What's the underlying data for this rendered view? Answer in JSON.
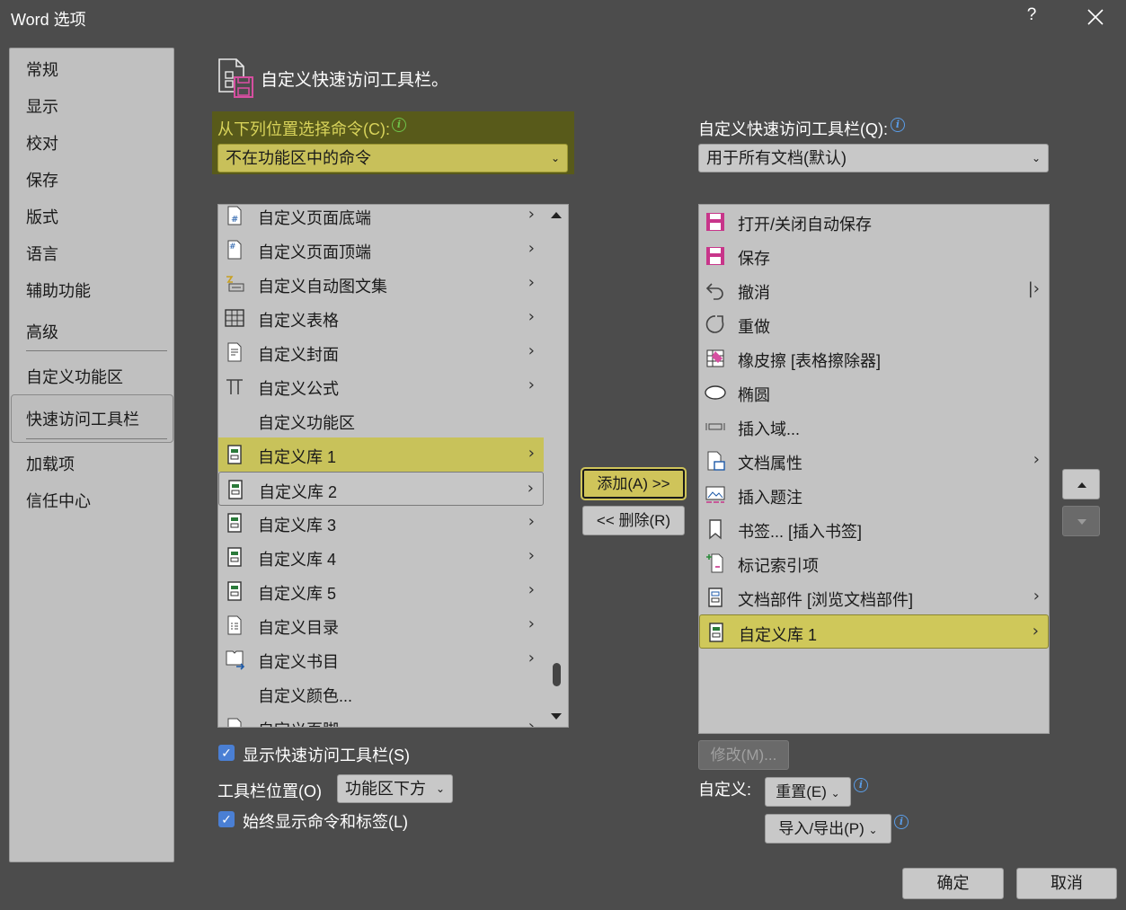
{
  "window": {
    "title": "Word 选项",
    "help": "?",
    "close": "✕"
  },
  "sidebar": {
    "items": [
      {
        "label": "常规"
      },
      {
        "label": "显示"
      },
      {
        "label": "校对"
      },
      {
        "label": "保存"
      },
      {
        "label": "版式"
      },
      {
        "label": "语言"
      },
      {
        "label": "辅助功能"
      },
      {
        "label": "高级"
      },
      {
        "label": "自定义功能区"
      },
      {
        "label": "快速访问工具栏"
      },
      {
        "label": "加载项"
      },
      {
        "label": "信任中心"
      }
    ],
    "selected": "快速访问工具栏"
  },
  "header": {
    "title": "自定义快速访问工具栏。"
  },
  "choose": {
    "label": "从下列位置选择命令(C):",
    "value": "不在功能区中的命令"
  },
  "commands": [
    {
      "label": "自定义页面底端",
      "icon": "page-number-bottom-icon",
      "arrow": ">"
    },
    {
      "label": "自定义页面顶端",
      "icon": "page-number-top-icon",
      "arrow": ">"
    },
    {
      "label": "自定义自动图文集",
      "icon": "autotext-icon",
      "arrow": ">"
    },
    {
      "label": "自定义表格",
      "icon": "table-icon",
      "arrow": ">"
    },
    {
      "label": "自定义封面",
      "icon": "cover-page-icon",
      "arrow": ">"
    },
    {
      "label": "自定义公式",
      "icon": "pi-icon",
      "arrow": ">"
    },
    {
      "label": "自定义功能区",
      "icon": "",
      "arrow": ""
    },
    {
      "label": "自定义库 1",
      "icon": "gallery-icon",
      "arrow": ">"
    },
    {
      "label": "自定义库 2",
      "icon": "gallery-icon",
      "arrow": ">"
    },
    {
      "label": "自定义库 3",
      "icon": "gallery-icon",
      "arrow": ">"
    },
    {
      "label": "自定义库 4",
      "icon": "gallery-icon",
      "arrow": ">"
    },
    {
      "label": "自定义库 5",
      "icon": "gallery-icon",
      "arrow": ">"
    },
    {
      "label": "自定义目录",
      "icon": "toc-icon",
      "arrow": ">"
    },
    {
      "label": "自定义书目",
      "icon": "bibliography-icon",
      "arrow": ">"
    },
    {
      "label": "自定义颜色...",
      "icon": "",
      "arrow": ""
    },
    {
      "label": "自定义页脚",
      "icon": "footer-icon",
      "arrow": ">"
    }
  ],
  "show_qat_label": "显示快速访问工具栏(S)",
  "toolbar_position": {
    "label": "工具栏位置(O)",
    "value": "功能区下方"
  },
  "always_show_label": "始终显示命令和标签(L)",
  "buttons": {
    "add": "添加(A) >>",
    "remove": "<< 删除(R)",
    "modify": "修改(M)...",
    "reset": "重置(E)",
    "import_export": "导入/导出(P)",
    "ok": "确定",
    "cancel": "取消"
  },
  "qat": {
    "label": "自定义快速访问工具栏(Q):",
    "value": "用于所有文档(默认)",
    "items": [
      {
        "label": "打开/关闭自动保存",
        "icon": "autosave-icon",
        "arrow": ""
      },
      {
        "label": "保存",
        "icon": "save-icon",
        "arrow": ""
      },
      {
        "label": "撤消",
        "icon": "undo-icon",
        "arrow": "|>"
      },
      {
        "label": "重做",
        "icon": "redo-icon",
        "arrow": ""
      },
      {
        "label": "橡皮擦 [表格擦除器]",
        "icon": "eraser-icon",
        "arrow": ""
      },
      {
        "label": "椭圆",
        "icon": "oval-icon",
        "arrow": ""
      },
      {
        "label": "插入域...",
        "icon": "field-icon",
        "arrow": ""
      },
      {
        "label": "文档属性",
        "icon": "document-property-icon",
        "arrow": ">"
      },
      {
        "label": "插入题注",
        "icon": "caption-icon",
        "arrow": ""
      },
      {
        "label": "书签... [插入书签]",
        "icon": "bookmark-icon",
        "arrow": ""
      },
      {
        "label": "标记索引项",
        "icon": "mark-entry-icon",
        "arrow": ""
      },
      {
        "label": "文档部件 [浏览文档部件]",
        "icon": "quick-parts-icon",
        "arrow": ">"
      },
      {
        "label": "自定义库 1",
        "icon": "gallery-icon",
        "arrow": ">"
      }
    ]
  },
  "customize_label": "自定义:",
  "colors": {
    "accent_yellow": "#c8c25a",
    "save_pink": "#c8358a",
    "checkbox_blue": "#4a7fd4"
  }
}
